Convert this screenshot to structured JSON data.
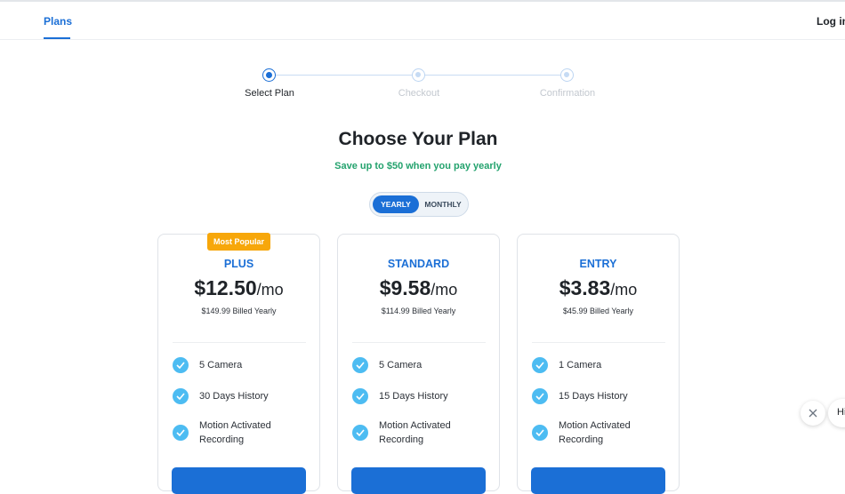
{
  "nav": {
    "plans_label": "Plans",
    "login_label": "Log in"
  },
  "stepper": {
    "steps": [
      {
        "label": "Select Plan",
        "active": true
      },
      {
        "label": "Checkout",
        "active": false
      },
      {
        "label": "Confirmation",
        "active": false
      }
    ]
  },
  "header": {
    "title": "Choose Your Plan",
    "subtitle": "Save up to $50 when you pay yearly"
  },
  "billing_toggle": {
    "yearly_label": "YEARLY",
    "monthly_label": "MONTHLY",
    "selected": "YEARLY"
  },
  "plans": [
    {
      "badge": "Most Popular",
      "name": "PLUS",
      "price": "$12.50",
      "per": "/mo",
      "billed": "$149.99 Billed Yearly",
      "features": [
        "5 Camera",
        "30 Days History",
        "Motion Activated Recording"
      ]
    },
    {
      "name": "STANDARD",
      "price": "$9.58",
      "per": "/mo",
      "billed": "$114.99 Billed Yearly",
      "features": [
        "5 Camera",
        "15 Days History",
        "Motion Activated Recording"
      ]
    },
    {
      "name": "ENTRY",
      "price": "$3.83",
      "per": "/mo",
      "billed": "$45.99 Billed Yearly",
      "features": [
        "1 Camera",
        "15 Days History",
        "Motion Activated Recording"
      ]
    }
  ],
  "chat": {
    "preview_text": "Hi"
  },
  "colors": {
    "accent": "#1b6fd6",
    "success": "#23a26d",
    "badge": "#f7a70a",
    "check": "#4dbcf2"
  }
}
